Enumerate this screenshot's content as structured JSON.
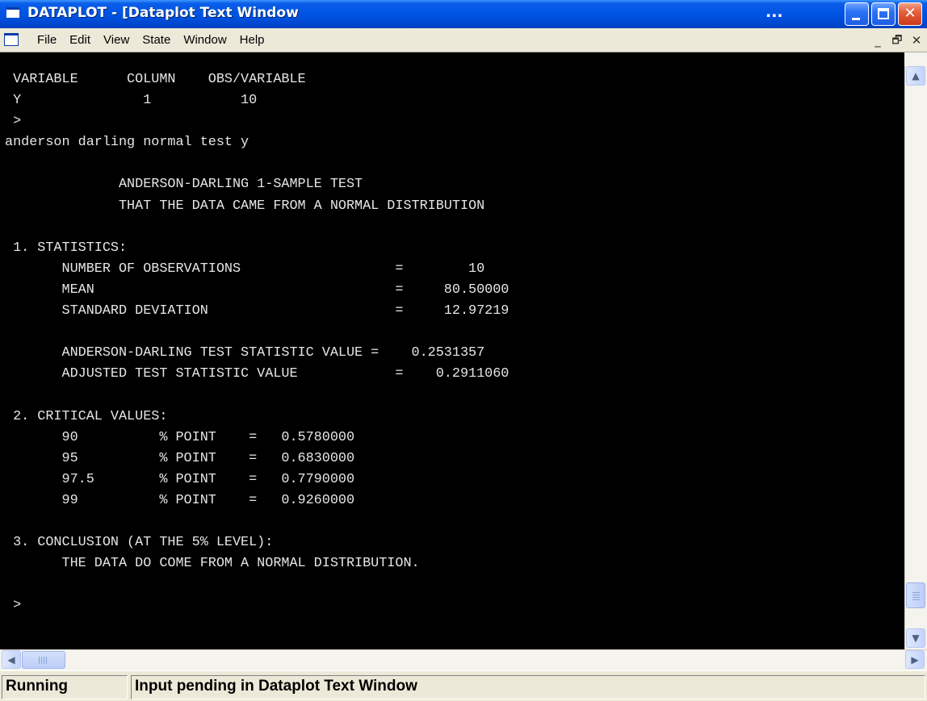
{
  "window": {
    "title": "DATAPLOT - [Dataplot Text Window",
    "title_overflow": "...",
    "close_glyph": "✕"
  },
  "menubar": {
    "items": [
      "File",
      "Edit",
      "View",
      "State",
      "Window",
      "Help"
    ],
    "mdi_min": "_",
    "mdi_restore": "🗗",
    "mdi_close": "✕"
  },
  "console": {
    "lines": [
      " VARIABLE      COLUMN    OBS/VARIABLE",
      " Y               1           10",
      " >",
      "anderson darling normal test y",
      "",
      "              ANDERSON-DARLING 1-SAMPLE TEST",
      "              THAT THE DATA CAME FROM A NORMAL DISTRIBUTION",
      "",
      " 1. STATISTICS:",
      "       NUMBER OF OBSERVATIONS                   =        10",
      "       MEAN                                     =     80.50000",
      "       STANDARD DEVIATION                       =     12.97219",
      "",
      "       ANDERSON-DARLING TEST STATISTIC VALUE =    0.2531357",
      "       ADJUSTED TEST STATISTIC VALUE            =    0.2911060",
      "",
      " 2. CRITICAL VALUES:",
      "       90          % POINT    =   0.5780000",
      "       95          % POINT    =   0.6830000",
      "       97.5        % POINT    =   0.7790000",
      "       99          % POINT    =   0.9260000",
      "",
      " 3. CONCLUSION (AT THE 5% LEVEL):",
      "       THE DATA DO COME FROM A NORMAL DISTRIBUTION.",
      "",
      " >"
    ]
  },
  "scrollbars": {
    "up_arrow": "▲",
    "down_arrow": "▼",
    "left_arrow": "◀",
    "right_arrow": "▶"
  },
  "statusbar": {
    "state": "Running",
    "message": "Input pending in Dataplot Text Window"
  },
  "colors": {
    "titlebar": "#0054e3",
    "console_bg": "#000000",
    "console_fg": "#e6e6e6",
    "chrome": "#ece9d8"
  }
}
